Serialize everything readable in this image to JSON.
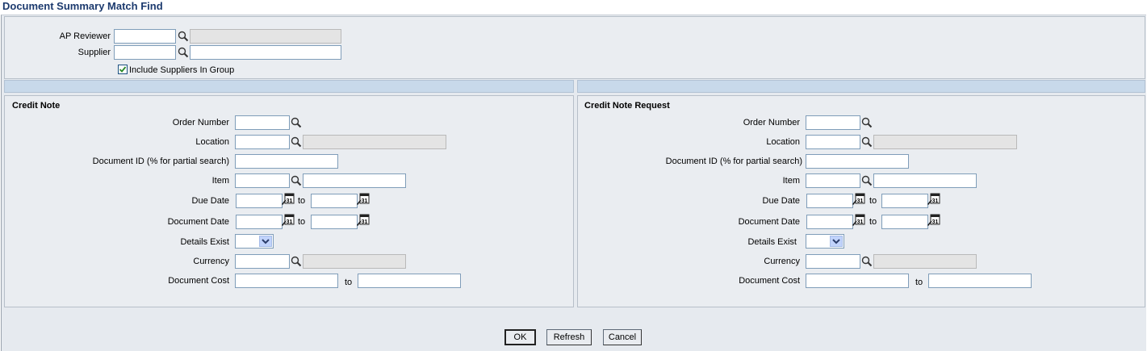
{
  "page": {
    "title": "Document Summary Match Find"
  },
  "header": {
    "ap_reviewer_label": "AP Reviewer",
    "supplier_label": "Supplier",
    "include_suppliers_label": "Include Suppliers In Group",
    "include_suppliers_checked": true,
    "ap_reviewer_value": "",
    "supplier_value": ""
  },
  "credit_note": {
    "title": "Credit Note",
    "order_number_label": "Order Number",
    "location_label": "Location",
    "document_id_label": "Document ID (% for partial search)",
    "item_label": "Item",
    "due_date_label": "Due Date",
    "document_date_label": "Document Date",
    "details_exist_label": "Details Exist",
    "currency_label": "Currency",
    "document_cost_label": "Document Cost",
    "to_label": "to"
  },
  "credit_note_request": {
    "title": "Credit Note Request",
    "order_number_label": "Order Number",
    "location_label": "Location",
    "document_id_label": "Document ID (% for partial search)",
    "item_label": "Item",
    "due_date_label": "Due Date",
    "document_date_label": "Document Date",
    "details_exist_label": "Details Exist",
    "currency_label": "Currency",
    "document_cost_label": "Document Cost",
    "to_label": "to"
  },
  "buttons": {
    "ok": "OK",
    "refresh": "Refresh",
    "cancel": "Cancel"
  },
  "icons": {
    "search": "magnifier-icon",
    "calendar": "calendar-icon",
    "calendar_day": "31"
  },
  "colors": {
    "title": "#1c3a6e",
    "background": "#e6eaef",
    "section_bar": "#c8d9ea",
    "readonly_field": "#e4e4e4",
    "checkbox_mark": "#2a8a2a"
  }
}
